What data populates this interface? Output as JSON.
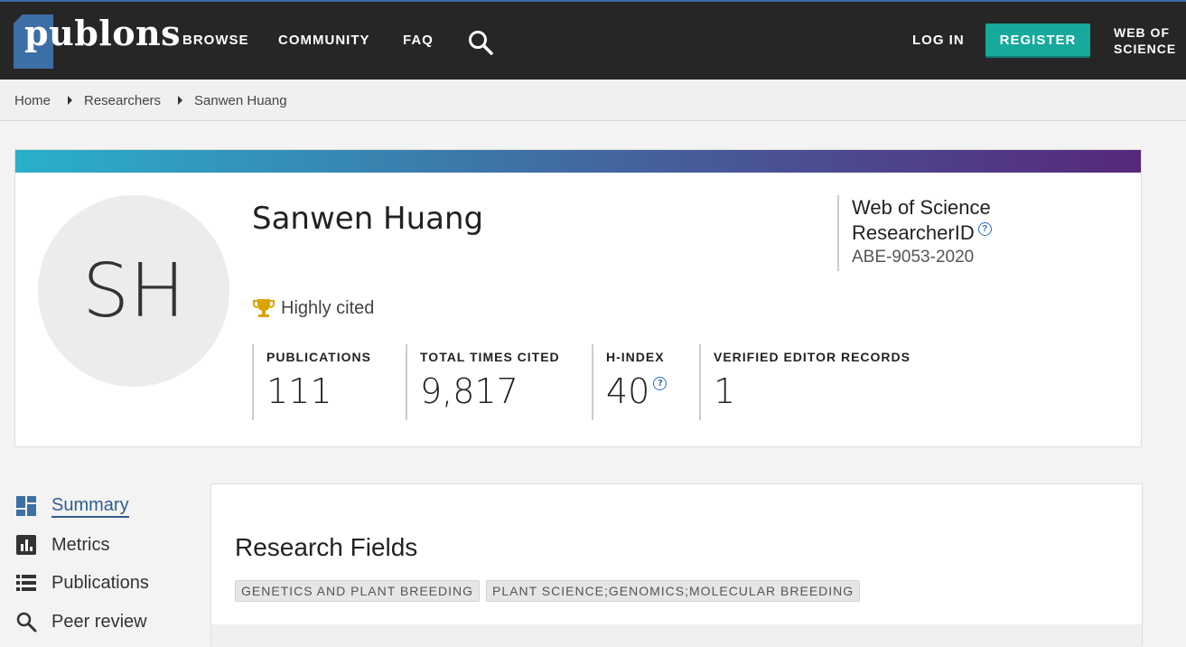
{
  "header": {
    "logo_text": "publons",
    "nav": [
      "BROWSE",
      "COMMUNITY",
      "FAQ"
    ],
    "login": "LOG IN",
    "register": "REGISTER",
    "wos_line1": "WEB OF",
    "wos_line2": "SCIENCE"
  },
  "breadcrumb": [
    "Home",
    "Researchers",
    "Sanwen Huang"
  ],
  "profile": {
    "initials": "SH",
    "name": "Sanwen Huang",
    "badge": "Highly cited",
    "wos_title_line1": "Web of Science",
    "wos_title_line2": "ResearcherID",
    "wos_id": "ABE-9053-2020",
    "help_glyph": "?"
  },
  "metrics": [
    {
      "label": "PUBLICATIONS",
      "value": "111"
    },
    {
      "label": "TOTAL TIMES CITED",
      "value": "9,817"
    },
    {
      "label": "H-INDEX",
      "value": "40"
    },
    {
      "label": "VERIFIED EDITOR RECORDS",
      "value": "1"
    }
  ],
  "sidebar": [
    {
      "label": "Summary",
      "icon": "dashboard-icon",
      "active": true
    },
    {
      "label": "Metrics",
      "icon": "bar-chart-icon"
    },
    {
      "label": "Publications",
      "icon": "list-icon"
    },
    {
      "label": "Peer review",
      "icon": "search-icon"
    }
  ],
  "research_fields": {
    "title": "Research Fields",
    "tags": [
      "GENETICS AND PLANT BREEDING",
      "PLANT SCIENCE;GENOMICS;MOLECULAR BREEDING"
    ]
  },
  "colors": {
    "topbar": "#262626",
    "accent": "#16a99c",
    "link_blue": "#2f5d8f",
    "trophy": "#d9a400"
  }
}
